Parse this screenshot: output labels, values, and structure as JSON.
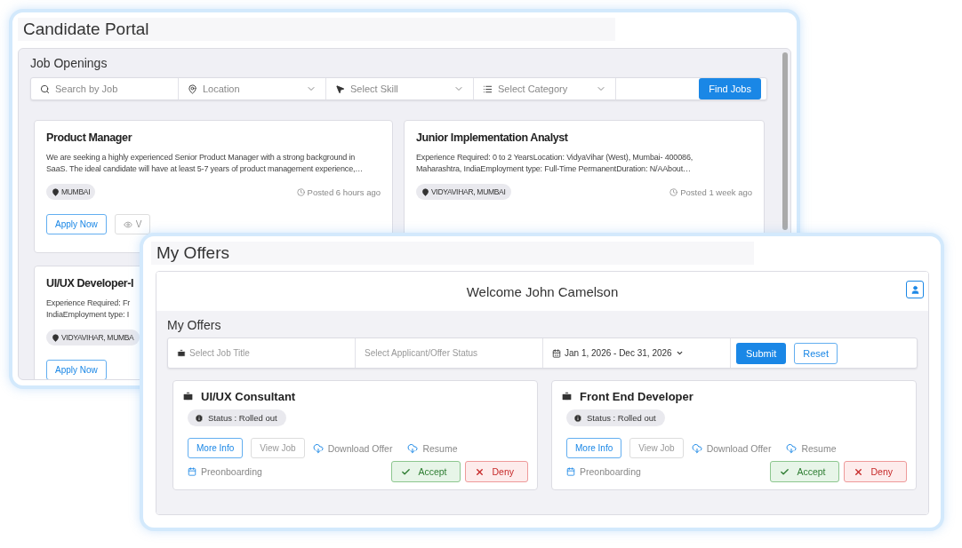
{
  "candidate_portal": {
    "title": "Candidate Portal",
    "section_title": "Job Openings",
    "filters": [
      {
        "kind": "search",
        "placeholder": "Search by Job"
      },
      {
        "kind": "location",
        "placeholder": "Location"
      },
      {
        "kind": "skill",
        "placeholder": "Select Skill"
      },
      {
        "kind": "category",
        "placeholder": "Select Category"
      }
    ],
    "find_button": "Find Jobs",
    "jobs": [
      {
        "title": "Product Manager",
        "lines": [
          "We are seeking a highly experienced Senior Product Manager with a strong background in",
          "SaaS. The ideal candidate will have at least 5-7 years of product management experience,…"
        ],
        "location": "MUMBAI",
        "posted": "Posted 6 hours ago",
        "buttons": [
          "Apply Now",
          "V"
        ]
      },
      {
        "title": "Junior Implementation Analyst",
        "lines": [
          "Experience Required: 0 to 2 YearsLocation: VidyaVihar (West), Mumbai- 400086,",
          "Maharashtra, IndiaEmployment type: Full-Time PermanentDuration: N/AAbout…"
        ],
        "location": "VIDYAVIHAR, MUMBAI",
        "posted": "Posted 1 week ago"
      },
      {
        "title": "UI/UX Developer-I",
        "lines": [
          "Experience Required: Fr",
          "IndiaEmployment type: I"
        ],
        "location": "VIDYAVIHAR, MUMBA",
        "buttons": [
          "Apply Now"
        ]
      }
    ]
  },
  "my_offers": {
    "title": "My Offers",
    "welcome": "Welcome John Camelson",
    "section_title": "My Offers",
    "filters": [
      {
        "kind": "job",
        "placeholder": "Select Job Title"
      },
      {
        "kind": "status",
        "placeholder": "Select Applicant/Offer Status"
      },
      {
        "kind": "date",
        "value": "Jan 1, 2026 - Dec 31, 2026"
      }
    ],
    "submit": "Submit",
    "reset": "Reset",
    "offers": [
      {
        "title": "UI/UX Consultant",
        "status": "Status : Rolled out",
        "actions": [
          {
            "kind": "outline",
            "label": "More Info"
          },
          {
            "kind": "disabled",
            "label": "View Job"
          },
          {
            "kind": "download",
            "label": "Download Offer"
          },
          {
            "kind": "download",
            "label": "Resume"
          }
        ],
        "link": "Preonboarding",
        "accept": "Accept",
        "deny": "Deny"
      },
      {
        "title": "Front End Developer",
        "status": "Status : Rolled out",
        "actions": [
          {
            "kind": "outline",
            "label": "More Info"
          },
          {
            "kind": "disabled",
            "label": "View Job"
          },
          {
            "kind": "download",
            "label": "Download Offer"
          },
          {
            "kind": "download",
            "label": "Resume"
          }
        ],
        "link": "Preonboarding",
        "accept": "Accept",
        "deny": "Deny"
      }
    ]
  }
}
